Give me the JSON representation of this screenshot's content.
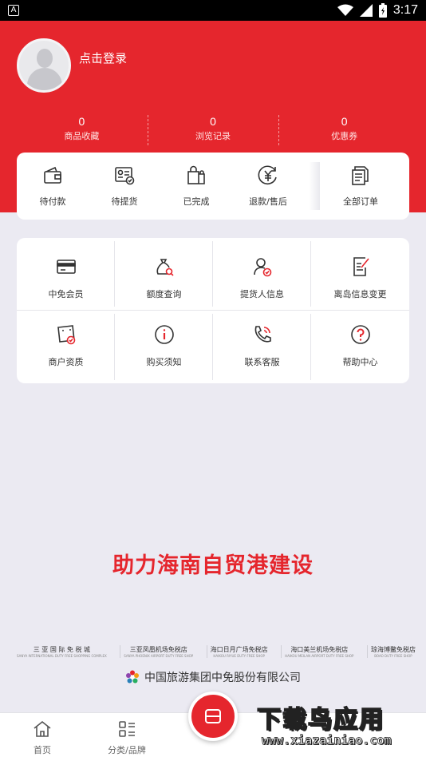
{
  "status_bar": {
    "time": "3:17",
    "left_icon_letter": "A"
  },
  "profile": {
    "login_label": "点击登录",
    "avatar_icon": "user-avatar-icon"
  },
  "stats": [
    {
      "value": "0",
      "label": "商品收藏"
    },
    {
      "value": "0",
      "label": "浏览记录"
    },
    {
      "value": "0",
      "label": "优惠券"
    }
  ],
  "orders": [
    {
      "label": "待付款",
      "icon": "wallet-icon"
    },
    {
      "label": "待提货",
      "icon": "pickup-card-icon"
    },
    {
      "label": "已完成",
      "icon": "shopping-bags-icon"
    },
    {
      "label": "退款/售后",
      "icon": "refund-yen-icon"
    },
    {
      "label": "全部订单",
      "icon": "document-list-icon"
    }
  ],
  "services": [
    {
      "label": "中免会员",
      "icon": "member-card-icon"
    },
    {
      "label": "额度查询",
      "icon": "quota-bag-icon"
    },
    {
      "label": "提货人信息",
      "icon": "pickup-person-icon"
    },
    {
      "label": "离岛信息变更",
      "icon": "edit-form-icon"
    },
    {
      "label": "商户资质",
      "icon": "merchant-qualification-icon"
    },
    {
      "label": "购买须知",
      "icon": "info-icon"
    },
    {
      "label": "联系客服",
      "icon": "phone-service-icon"
    },
    {
      "label": "帮助中心",
      "icon": "help-icon"
    }
  ],
  "slogan": "助力海南自贸港建设",
  "partners": [
    {
      "name": "三 亚 国 际 免 税 城",
      "sub": "SANYA INTERNATIONAL DUTY FREE SHOPPING COMPLEX"
    },
    {
      "name": "三亚凤凰机场免税店",
      "sub": "SANYA PHOENIX AIRPORT DUTY FREE SHOP"
    },
    {
      "name": "海口日月广场免税店",
      "sub": "HAIKOU RIYUE DUTY FREE SHOP"
    },
    {
      "name": "海口美兰机场免税店",
      "sub": "HAIKOU MEILAN AIRPORT DUTY FREE SHOP"
    },
    {
      "name": "琼海博鳌免税店",
      "sub": "BOAO DUTY FREE SHOP"
    }
  ],
  "company": "中国旅游集团中免股份有限公司",
  "bottom_nav": [
    {
      "label": "首页",
      "icon": "home-icon"
    },
    {
      "label": "分类/品牌",
      "icon": "category-icon"
    }
  ],
  "watermark": {
    "title": "下载鸟应用",
    "url": "www.xiazainiao.com"
  },
  "colors": {
    "brand_red": "#e5262d",
    "background": "#ebeaf2",
    "card": "#ffffff"
  }
}
